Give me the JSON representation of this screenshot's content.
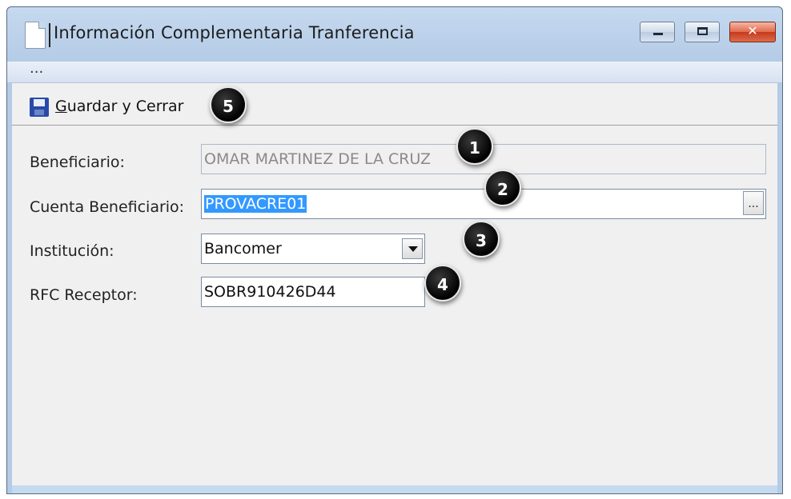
{
  "window": {
    "title": "Información Complementaria Tranferencia",
    "controls": {
      "minimize_icon": "minimize-icon",
      "maximize_icon": "maximize-icon",
      "close_icon": "close-icon",
      "close_glyph": "✕"
    }
  },
  "menubar": {
    "overflow_label": "..."
  },
  "toolbar": {
    "save_close_access_key": "G",
    "save_close_rest": "uardar y Cerrar",
    "save_icon": "save-icon"
  },
  "form": {
    "beneficiario": {
      "label": "Beneficiario:",
      "value": "OMAR MARTINEZ DE LA CRUZ"
    },
    "cuenta_beneficiario": {
      "label": "Cuenta Beneficiario:",
      "value": "PROVACRE01",
      "browse_label": "..."
    },
    "institucion": {
      "label": "Institución:",
      "selected": "Bancomer"
    },
    "rfc_receptor": {
      "label": "RFC Receptor:",
      "value": "SOBR910426D44"
    }
  },
  "annotations": [
    "1",
    "2",
    "3",
    "4",
    "5"
  ],
  "colors": {
    "selection": "#3399ff",
    "close_button": "#c8391c",
    "window_frame": "#c5d9ef"
  }
}
